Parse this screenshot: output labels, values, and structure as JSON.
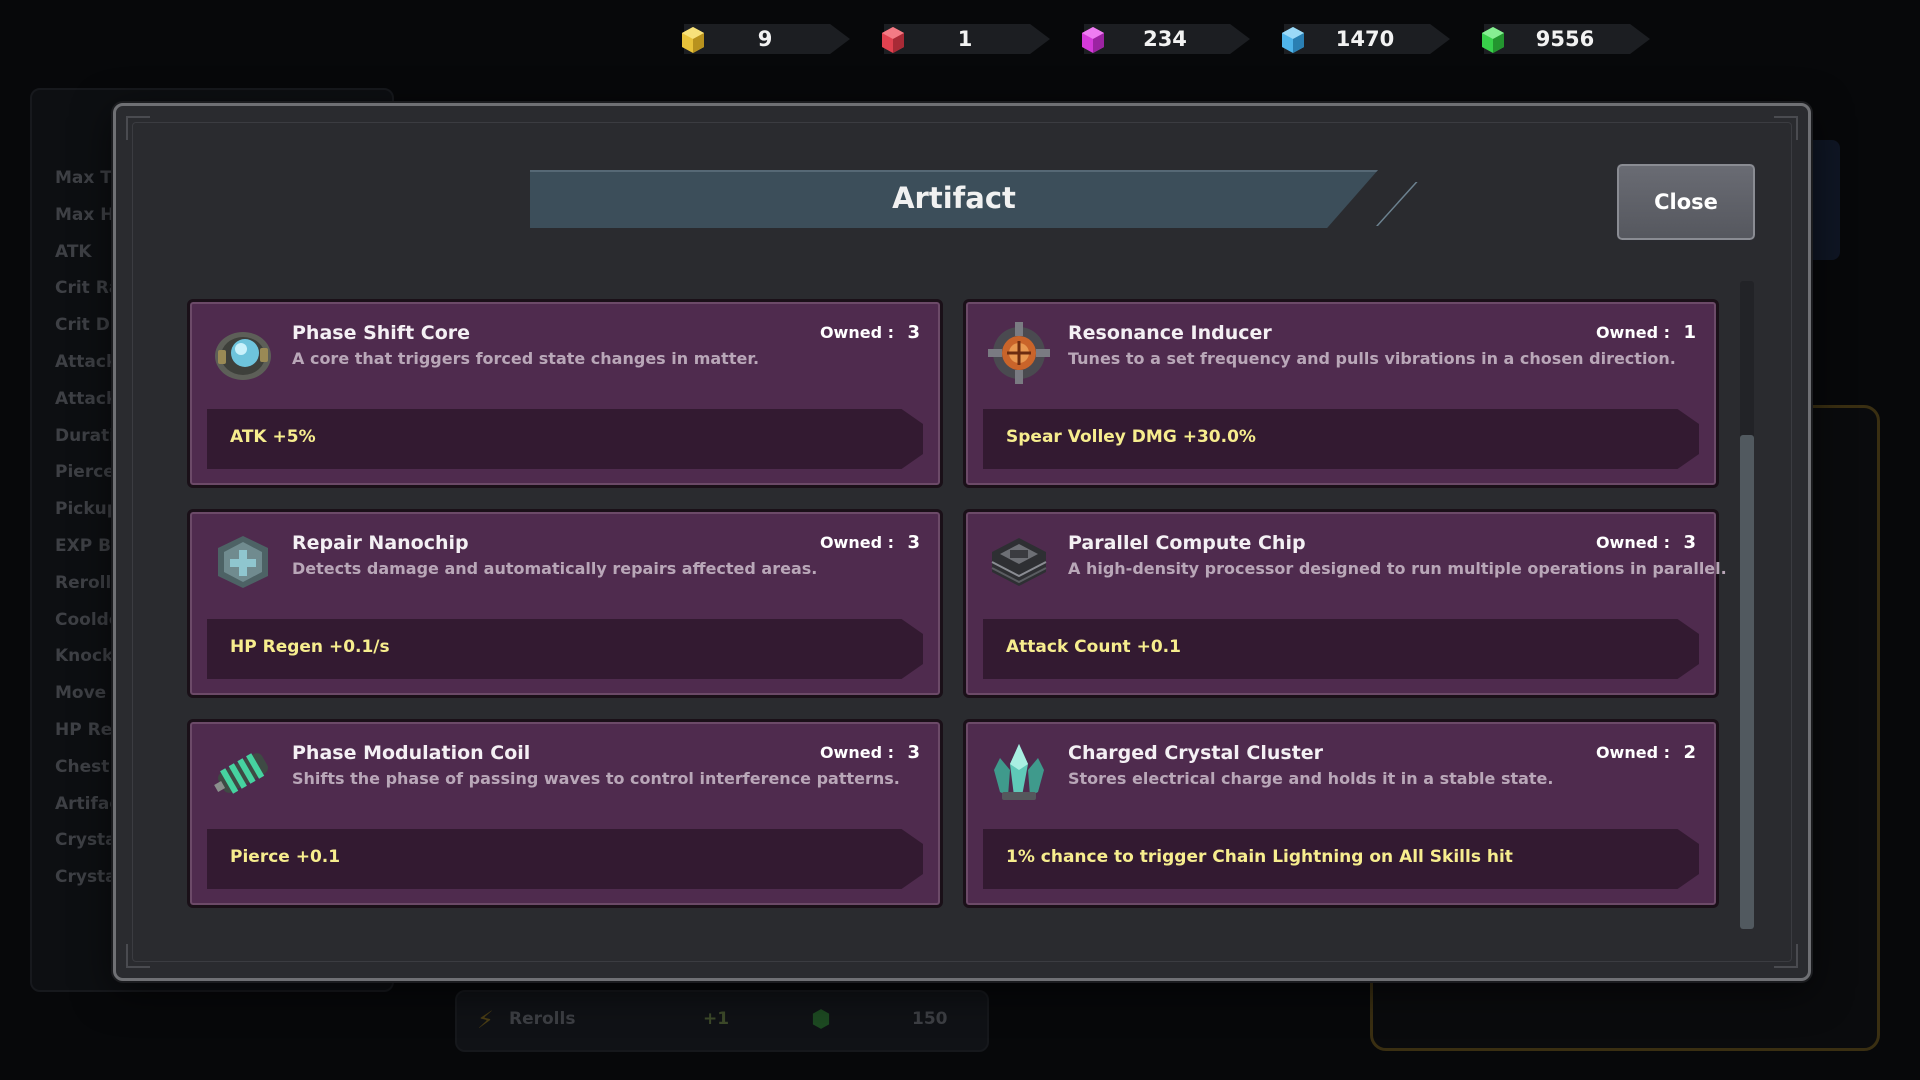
{
  "background": {
    "stats": [
      "Max Ti",
      "Max H",
      "ATK",
      "Crit Ra",
      "Crit DN",
      "Attack",
      "Attack",
      "Durati",
      "Pierce",
      "Pickup",
      "EXP Bo",
      "Rerolls",
      "Cooldo",
      "Knock",
      "Move S",
      "HP Reg",
      "Chest",
      "Artifac",
      "Crysta",
      "Crysta"
    ],
    "reroll": {
      "label": "Rerolls",
      "plus": "+1",
      "cost": "150"
    }
  },
  "currencies": [
    {
      "icon": "yellow-gem-icon",
      "color": "#e8c23a",
      "value": "9"
    },
    {
      "icon": "red-gem-icon",
      "color": "#e0414f",
      "value": "1"
    },
    {
      "icon": "purple-gem-icon",
      "color": "#d43ad9",
      "value": "234"
    },
    {
      "icon": "blue-gem-icon",
      "color": "#4fb4ea",
      "value": "1470"
    },
    {
      "icon": "green-gem-icon",
      "color": "#38d14a",
      "value": "9556"
    }
  ],
  "modal": {
    "title": "Artifact",
    "close_label": "Close",
    "owned_label": "Owned :",
    "scroll_position": 0.3,
    "artifacts": [
      {
        "name": "Phase Shift Core",
        "description": "A core that triggers forced state changes in matter.",
        "owned": "3",
        "effect": "ATK +5%",
        "icon": "phase-shift-core-icon"
      },
      {
        "name": "Resonance Inducer",
        "description": "Tunes to a set frequency and pulls vibrations in a chosen direction.",
        "owned": "1",
        "effect": "Spear Volley DMG +30.0%",
        "icon": "resonance-inducer-icon"
      },
      {
        "name": "Repair Nanochip",
        "description": "Detects damage and automatically repairs affected areas.",
        "owned": "3",
        "effect": "HP Regen +0.1/s",
        "icon": "repair-nanochip-icon"
      },
      {
        "name": "Parallel Compute Chip",
        "description": "A high-density processor designed to run multiple operations in parallel.",
        "owned": "3",
        "effect": "Attack Count +0.1",
        "icon": "parallel-compute-chip-icon"
      },
      {
        "name": "Phase Modulation Coil",
        "description": "Shifts the phase of passing waves to control interference patterns.",
        "owned": "3",
        "effect": "Pierce +0.1",
        "icon": "phase-modulation-coil-icon"
      },
      {
        "name": "Charged Crystal Cluster",
        "description": "Stores electrical charge and holds it in a stable state.",
        "owned": "2",
        "effect": "1% chance to trigger Chain Lightning on All Skills hit",
        "icon": "charged-crystal-cluster-icon"
      }
    ]
  },
  "colors": {
    "card_bg": "#4f2b4e",
    "effect_text": "#f7ed8e",
    "title_banner": "#3c4e5a"
  }
}
